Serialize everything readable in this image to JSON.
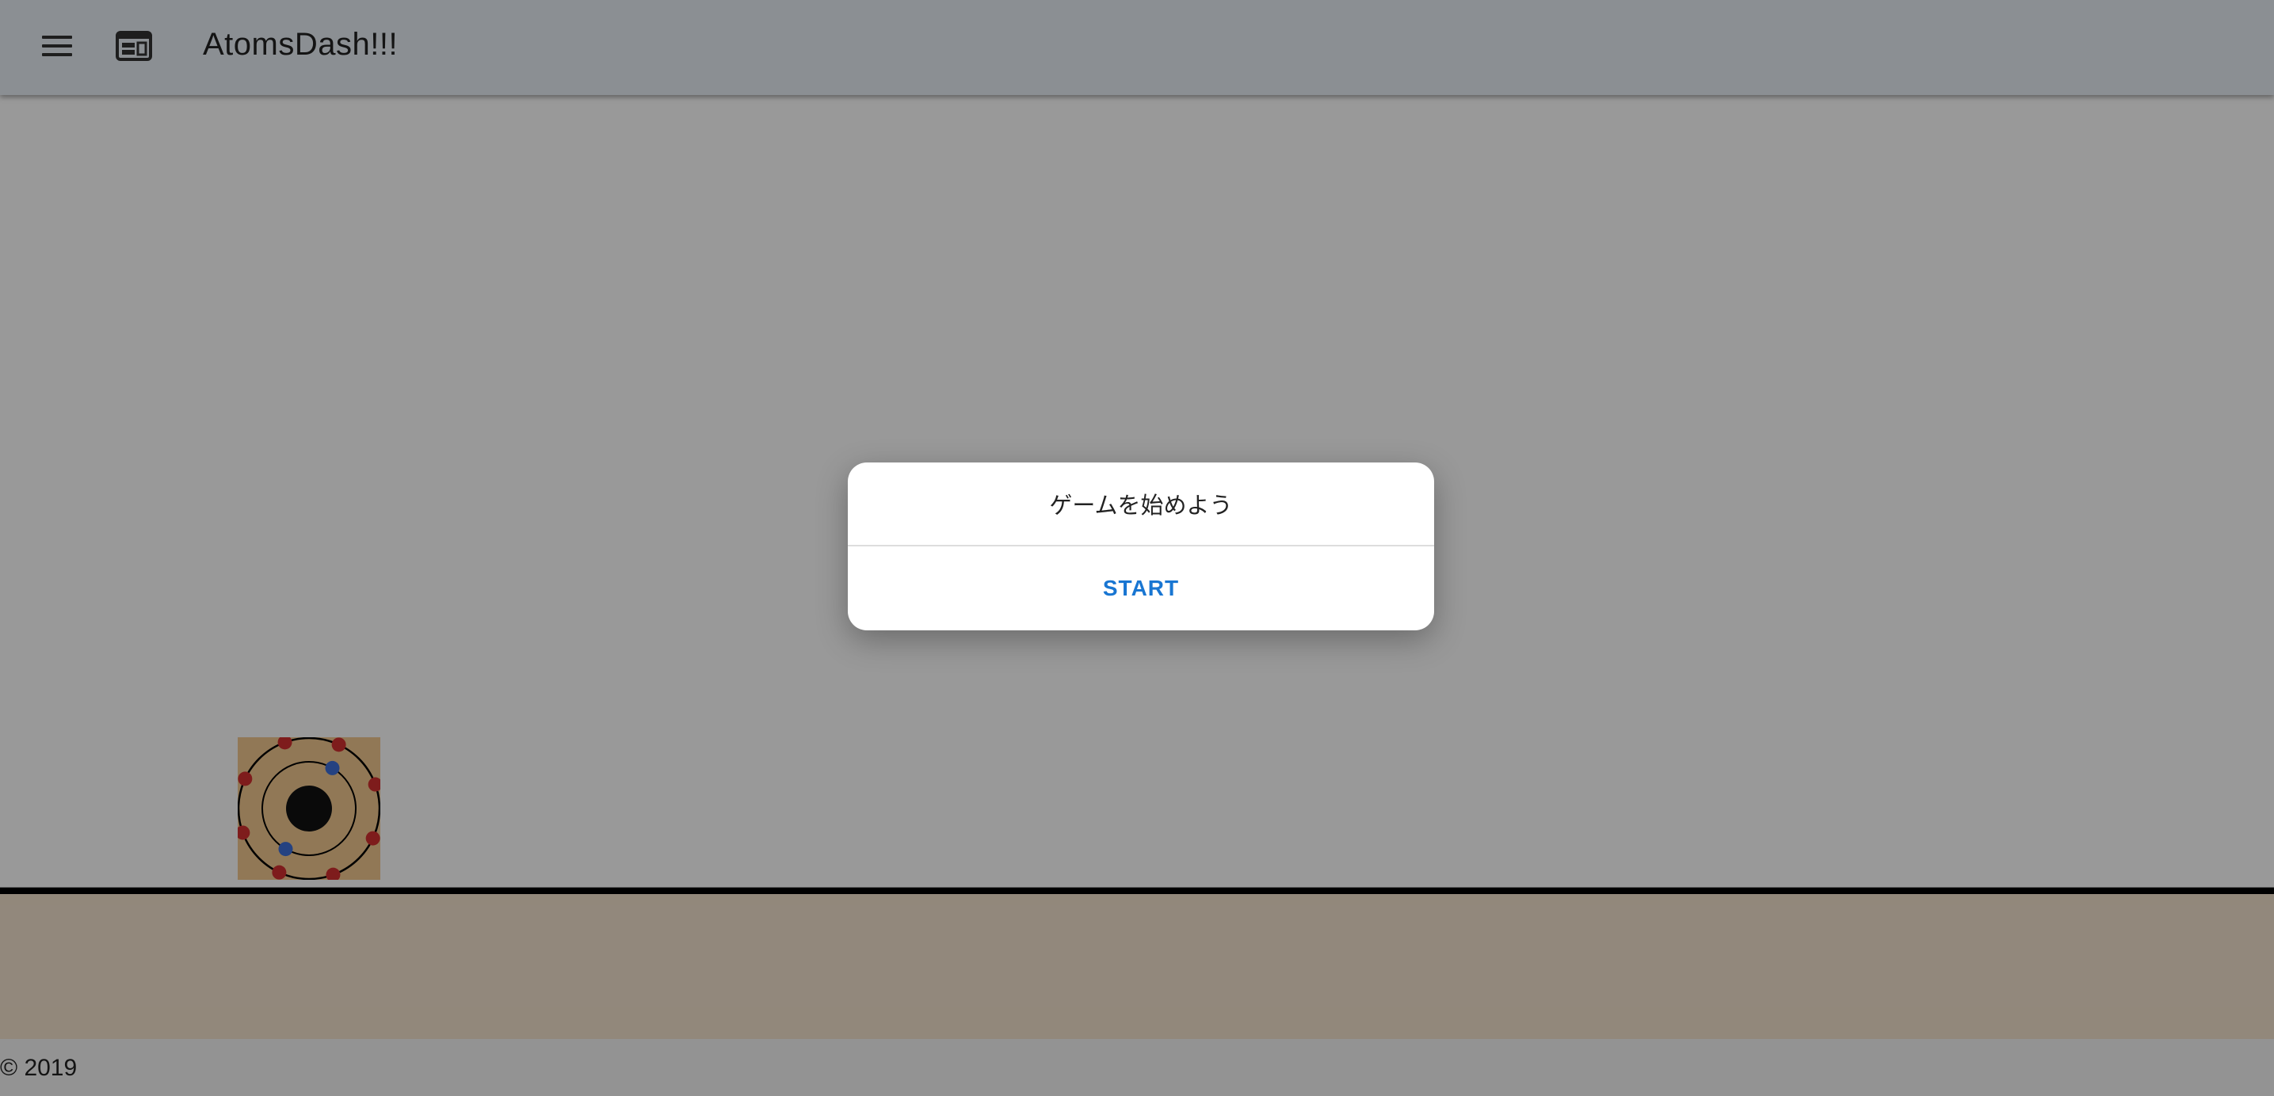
{
  "app_bar": {
    "title": "AtomsDash!!!",
    "menu_icon": "hamburger-menu-icon",
    "layout_icon": "web-layout-icon",
    "background": "#e8eef5"
  },
  "game": {
    "background": "#ffffff",
    "ground_color": "#f3e3ce",
    "player": {
      "icon": "atom-icon",
      "inner_electrons": 2,
      "outer_electrons": 8,
      "inner_electron_color": "#3f6fd8",
      "outer_electron_color": "#d23030",
      "nucleus_color": "#111111",
      "tile_color": "#f2c98f"
    }
  },
  "dialog": {
    "message": "ゲームを始めよう",
    "button_label": "START",
    "button_color": "#1976d2"
  },
  "footer": {
    "text": "© 2019"
  }
}
